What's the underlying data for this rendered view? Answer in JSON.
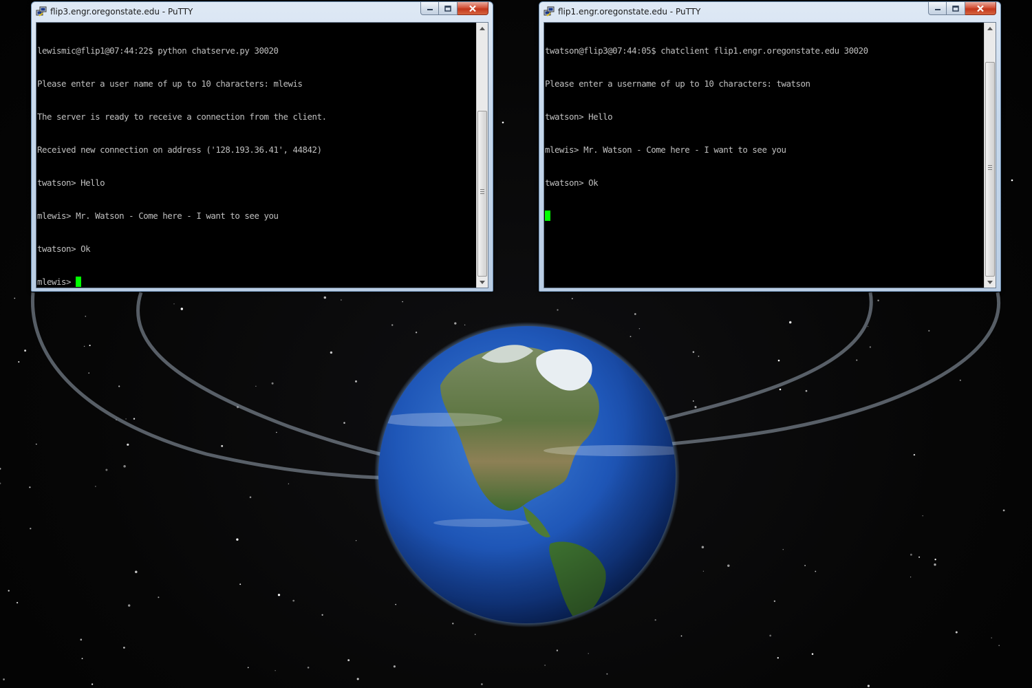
{
  "desktop": {
    "background": "Google Earth globe in space with orbit trails"
  },
  "colors": {
    "terminal_bg": "#000000",
    "terminal_fg": "#c0c0c0",
    "cursor": "#00ff00",
    "titlebar": "#c6d8ec",
    "close_button": "#c3371c"
  },
  "windows": [
    {
      "app_icon": "putty-icon",
      "title": "flip3.engr.oregonstate.edu - PuTTY",
      "lines": [
        "lewismic@flip1@07:44:22$ python chatserve.py 30020",
        "Please enter a user name of up to 10 characters: mlewis",
        "The server is ready to receive a connection from the client.",
        "Received new connection on address ('128.193.36.41', 44842)",
        "twatson> Hello",
        "mlewis> Mr. Watson - Come here - I want to see you",
        "twatson> Ok"
      ],
      "prompt": "mlewis> "
    },
    {
      "app_icon": "putty-icon",
      "title": "flip1.engr.oregonstate.edu - PuTTY",
      "lines": [
        "twatson@flip3@07:44:05$ chatclient flip1.engr.oregonstate.edu 30020",
        "Please enter a username of up to 10 characters: twatson",
        "twatson> Hello",
        "mlewis> Mr. Watson - Come here - I want to see you",
        "twatson> Ok"
      ],
      "prompt": ""
    }
  ]
}
